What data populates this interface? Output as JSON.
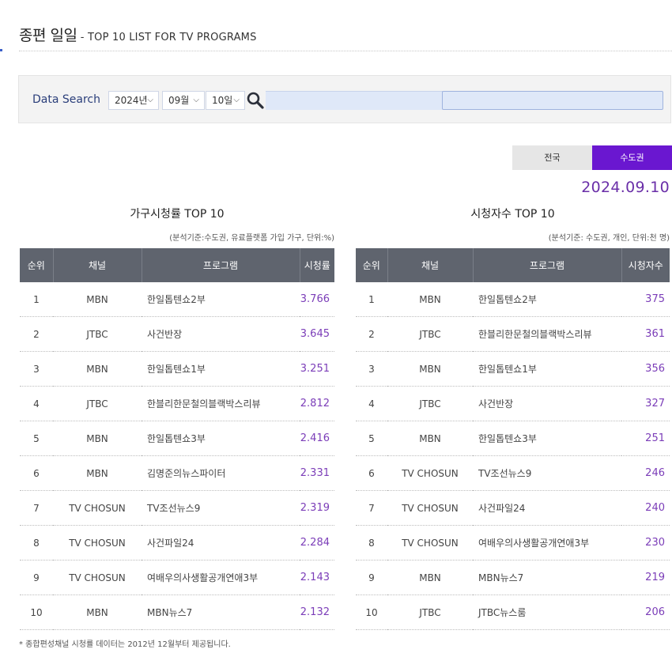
{
  "header": {
    "title": "종편 일일",
    "subtitle": " - TOP 10 LIST FOR TV PROGRAMS"
  },
  "search": {
    "label": "Data Search",
    "year": "2024년",
    "month": "09월",
    "day": "10일",
    "chevron": "⌵"
  },
  "region_tabs": {
    "all": "전국",
    "metro": "수도권",
    "active": "수도권",
    "active_color": "#6a17d0"
  },
  "date": "2024.09.10",
  "household": {
    "title": "가구시청률 TOP 10",
    "note": "(분석기준:수도권, 유료플랫폼 가입 가구, 단위:%)",
    "columns": [
      "순위",
      "채널",
      "프로그램",
      "시청률"
    ],
    "rows": [
      {
        "rank": "1",
        "channel": "MBN",
        "program": "한일톱텐쇼2부",
        "value": "3.766"
      },
      {
        "rank": "2",
        "channel": "JTBC",
        "program": "사건반장",
        "value": "3.645"
      },
      {
        "rank": "3",
        "channel": "MBN",
        "program": "한일톱텐쇼1부",
        "value": "3.251"
      },
      {
        "rank": "4",
        "channel": "JTBC",
        "program": "한블리한문철의블랙박스리뷰",
        "value": "2.812"
      },
      {
        "rank": "5",
        "channel": "MBN",
        "program": "한일톱텐쇼3부",
        "value": "2.416"
      },
      {
        "rank": "6",
        "channel": "MBN",
        "program": "김명준의뉴스파이터",
        "value": "2.331"
      },
      {
        "rank": "7",
        "channel": "TV CHOSUN",
        "program": "TV조선뉴스9",
        "value": "2.319"
      },
      {
        "rank": "8",
        "channel": "TV CHOSUN",
        "program": "사건파일24",
        "value": "2.284"
      },
      {
        "rank": "9",
        "channel": "TV CHOSUN",
        "program": "여배우의사생활공개연애3부",
        "value": "2.143"
      },
      {
        "rank": "10",
        "channel": "MBN",
        "program": "MBN뉴스7",
        "value": "2.132"
      }
    ]
  },
  "viewers": {
    "title": "시청자수 TOP 10",
    "note": "(분석기준: 수도권, 개인, 단위:천 명)",
    "columns": [
      "순위",
      "채널",
      "프로그램",
      "시청자수"
    ],
    "rows": [
      {
        "rank": "1",
        "channel": "MBN",
        "program": "한일톱텐쇼2부",
        "value": "375"
      },
      {
        "rank": "2",
        "channel": "JTBC",
        "program": "한블리한문철의블랙박스리뷰",
        "value": "361"
      },
      {
        "rank": "3",
        "channel": "MBN",
        "program": "한일톱텐쇼1부",
        "value": "356"
      },
      {
        "rank": "4",
        "channel": "JTBC",
        "program": "사건반장",
        "value": "327"
      },
      {
        "rank": "5",
        "channel": "MBN",
        "program": "한일톱텐쇼3부",
        "value": "251"
      },
      {
        "rank": "6",
        "channel": "TV CHOSUN",
        "program": "TV조선뉴스9",
        "value": "246"
      },
      {
        "rank": "7",
        "channel": "TV CHOSUN",
        "program": "사건파일24",
        "value": "240"
      },
      {
        "rank": "8",
        "channel": "TV CHOSUN",
        "program": "여배우의사생활공개연애3부",
        "value": "230"
      },
      {
        "rank": "9",
        "channel": "MBN",
        "program": "MBN뉴스7",
        "value": "219"
      },
      {
        "rank": "10",
        "channel": "JTBC",
        "program": "JTBC뉴스룸",
        "value": "206"
      }
    ]
  },
  "footnote": "* 종합편성채널 시청률 데이터는 2012년 12월부터 제공됩니다.",
  "colors": {
    "accent_purple": "#6a17d0",
    "value_text": "#7b3db8",
    "table_header": "#5f646e"
  }
}
